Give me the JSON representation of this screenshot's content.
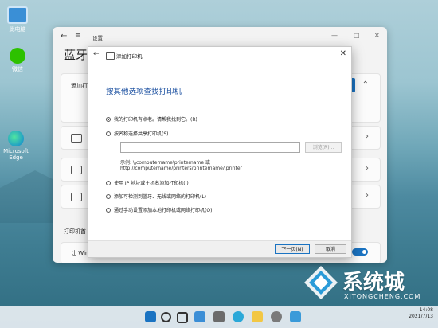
{
  "desktop": {
    "icons": [
      {
        "label": "此电脑",
        "icon": "computer-icon"
      },
      {
        "label": "微信",
        "icon": "wechat-icon"
      },
      {
        "label": "Microsoft Edge",
        "icon": "edge-icon"
      }
    ]
  },
  "settings": {
    "title": "设置",
    "page_title": "蓝牙",
    "add_device_label": "添加打",
    "printers_section": "打印机首",
    "let_windows_label": "让 Win"
  },
  "dialog": {
    "title": "添加打印机",
    "heading": "按其他选项查找打印机",
    "options": [
      {
        "label": "我的打印机有点老。请帮我找到它。(R)",
        "selected": true
      },
      {
        "label": "按名称选择共享打印机(S)",
        "selected": false
      },
      {
        "label": "使用 IP 地址或主机名添加打印机(I)",
        "selected": false
      },
      {
        "label": "添加可检测到蓝牙、无线或网络的打印机(L)",
        "selected": false
      },
      {
        "label": "通过手动设置添加本地打印机或网络打印机(O)",
        "selected": false
      }
    ],
    "path_value": "",
    "browse_label": "浏览(R)...",
    "example_line1": "示例: \\\\computername\\printername 或",
    "example_line2": "http://computername/printers/printername/.printer",
    "next_label": "下一页(N)",
    "cancel_label": "取消"
  },
  "watermark": {
    "cn": "系统城",
    "en": "XITONGCHENG.COM"
  },
  "clock": {
    "time": "14:08",
    "date": "2021/7/13"
  },
  "colors": {
    "accent": "#1a73c2",
    "heading": "#1a4fa0"
  }
}
